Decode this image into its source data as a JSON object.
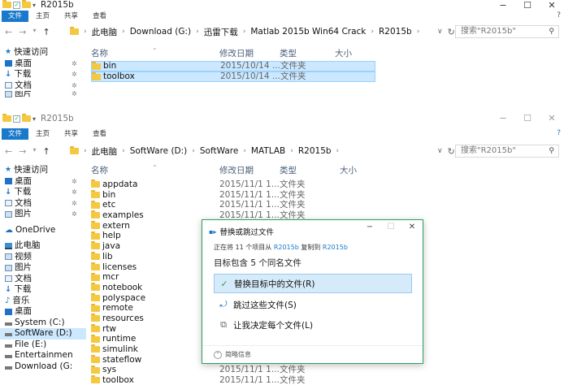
{
  "win1": {
    "title": "R2015b",
    "tabs": [
      "文件",
      "主页",
      "共享",
      "查看"
    ],
    "breadcrumb": [
      "此电脑",
      "Download (G:)",
      "迅雷下载",
      "Matlab 2015b Win64 Crack",
      "R2015b"
    ],
    "search_placeholder": "搜索\"R2015b\"",
    "columns": {
      "name": "名称",
      "date": "修改日期",
      "type": "类型",
      "size": "大小"
    },
    "nav": [
      {
        "label": "快速访问",
        "icon": "star-icon"
      },
      {
        "label": "桌面",
        "icon": "desktop-icon",
        "pinned": true
      },
      {
        "label": "下载",
        "icon": "download-icon",
        "pinned": true
      },
      {
        "label": "文档",
        "icon": "document-icon",
        "pinned": true
      },
      {
        "label": "图片",
        "icon": "picture-icon",
        "pinned": true
      }
    ],
    "files": [
      {
        "name": "bin",
        "date": "2015/10/14 ...",
        "type": "文件夹"
      },
      {
        "name": "toolbox",
        "date": "2015/10/14 ...",
        "type": "文件夹"
      }
    ]
  },
  "win2": {
    "title": "R2015b",
    "tabs": [
      "文件",
      "主页",
      "共享",
      "查看"
    ],
    "breadcrumb": [
      "此电脑",
      "SoftWare (D:)",
      "SoftWare",
      "MATLAB",
      "R2015b"
    ],
    "search_placeholder": "搜索\"R2015b\"",
    "columns": {
      "name": "名称",
      "date": "修改日期",
      "type": "类型",
      "size": "大小"
    },
    "nav": [
      {
        "label": "快速访问",
        "icon": "star-icon"
      },
      {
        "label": "桌面",
        "icon": "desktop-icon",
        "pinned": true
      },
      {
        "label": "下载",
        "icon": "download-icon",
        "pinned": true
      },
      {
        "label": "文档",
        "icon": "document-icon",
        "pinned": true
      },
      {
        "label": "图片",
        "icon": "picture-icon",
        "pinned": true
      },
      {
        "label": "",
        "icon": ""
      },
      {
        "label": "OneDrive",
        "icon": "cloud-icon"
      },
      {
        "label": "",
        "icon": ""
      },
      {
        "label": "此电脑",
        "icon": "computer-icon"
      },
      {
        "label": "视频",
        "icon": "video-icon"
      },
      {
        "label": "图片",
        "icon": "picture-icon"
      },
      {
        "label": "文档",
        "icon": "document-icon"
      },
      {
        "label": "下载",
        "icon": "download-icon"
      },
      {
        "label": "音乐",
        "icon": "music-icon"
      },
      {
        "label": "桌面",
        "icon": "desktop-icon"
      },
      {
        "label": "System (C:)",
        "icon": "drive-icon"
      },
      {
        "label": "SoftWare (D:)",
        "icon": "drive-icon",
        "selected": true
      },
      {
        "label": "File (E:)",
        "icon": "drive-icon"
      },
      {
        "label": "Entertainmen",
        "icon": "drive-icon"
      },
      {
        "label": "Download (G:",
        "icon": "drive-icon"
      }
    ],
    "files": [
      {
        "name": "appdata",
        "date": "2015/11/1 1...",
        "type": "文件夹"
      },
      {
        "name": "bin",
        "date": "2015/11/1 1...",
        "type": "文件夹"
      },
      {
        "name": "etc",
        "date": "2015/11/1 1...",
        "type": "文件夹"
      },
      {
        "name": "examples",
        "date": "2015/11/1 1...",
        "type": "文件夹"
      },
      {
        "name": "extern",
        "date": "",
        "type": ""
      },
      {
        "name": "help",
        "date": "",
        "type": ""
      },
      {
        "name": "java",
        "date": "",
        "type": ""
      },
      {
        "name": "lib",
        "date": "",
        "type": ""
      },
      {
        "name": "licenses",
        "date": "",
        "type": ""
      },
      {
        "name": "mcr",
        "date": "",
        "type": ""
      },
      {
        "name": "notebook",
        "date": "",
        "type": ""
      },
      {
        "name": "polyspace",
        "date": "",
        "type": ""
      },
      {
        "name": "remote",
        "date": "",
        "type": ""
      },
      {
        "name": "resources",
        "date": "",
        "type": ""
      },
      {
        "name": "rtw",
        "date": "",
        "type": ""
      },
      {
        "name": "runtime",
        "date": "",
        "type": ""
      },
      {
        "name": "simulink",
        "date": "",
        "type": ""
      },
      {
        "name": "stateflow",
        "date": "",
        "type": ""
      },
      {
        "name": "sys",
        "date": "2015/11/1 1...",
        "type": "文件夹"
      },
      {
        "name": "toolbox",
        "date": "2015/11/1 1...",
        "type": "文件夹"
      }
    ]
  },
  "dialog": {
    "title": "替换或跳过文件",
    "info_prefix": "正在将 11 个项目从 ",
    "info_src": "R2015b",
    "info_mid": " 复制到 ",
    "info_dst": "R2015b",
    "heading": "目标包含 5 个同名文件",
    "opt_replace": "替换目标中的文件(R)",
    "opt_skip": "跳过这些文件(S)",
    "opt_decide": "让我决定每个文件(L)",
    "more": "简略信息"
  },
  "colors": {
    "accent": "#1979ca",
    "selection": "#cce8ff",
    "folder": "#f5c842",
    "dialog_border": "#2ca05a"
  }
}
